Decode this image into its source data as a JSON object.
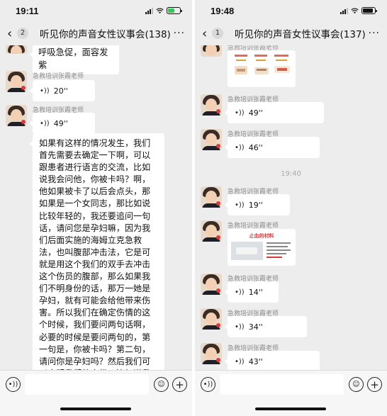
{
  "left": {
    "status": {
      "time": "19:11"
    },
    "nav": {
      "back_count": "2",
      "title": "听见你的声音女性议事会(138)",
      "more": "···"
    },
    "messages": {
      "top_text": "呼吸急促，面容发紫",
      "m1_sender": "急救培训张霞老师",
      "m1_duration": "20''",
      "m2_sender": "急救培训张霞老师",
      "m2_duration": "49''",
      "long_text": "如果有这样的情况发生，我们首先需要去确定一下啊，可以跟患者进行语言的交流，比如说我会问他，你被卡吗？啊，他如果被卡了以后会点头，那如果是一个女同志，那比如说比较年轻的，我还要追问一句话，请问您是孕妇嘛，因为我们后面实施的海姆立克急救法，也叫腹部冲击法，它是可就是用这个我们的双手去冲击这个伤员的腹部，那么如果我们不明身份的话，那万一她是孕妇，就有可能会给他带来伤害。所以我们在确定伤情的这个时候，我们要问两句话啊，必要的时候是要问两句的，第一句是，你被卡吗？第二句，请问你是孕妇吗？然后我们可以亮明我们的身份，比如说我学过急救，我可以帮助你。"
    }
  },
  "right": {
    "status": {
      "time": "19:48"
    },
    "nav": {
      "back_count": "1",
      "title": "听见你的声音女性议事会(137)",
      "more": "···"
    },
    "messages": {
      "top_sender": "急救培训张霞老师",
      "m1_sender": "急救培训张霞老师",
      "m1_duration": "49''",
      "m2_sender": "急救培训张霞老师",
      "m2_duration": "46''",
      "time_sep": "19:40",
      "m3_sender": "急救培训张霞老师",
      "m3_duration": "19''",
      "m4_sender": "急救培训张霞老师",
      "m4_image_title": "止血的材料",
      "m5_sender": "急救培训张霞老师",
      "m5_duration": "14''",
      "m6_sender": "急救培训张霞老师",
      "m6_duration": "34''",
      "m7_sender": "急救培训张霞老师",
      "m7_duration": "43''"
    }
  },
  "icons": {
    "voice_wave": "voice-wave-icon",
    "voice_toggle": "voice-toggle-icon",
    "emoji": "emoji-icon",
    "plus": "plus-icon"
  },
  "colors": {
    "chat_bg": "#ededed",
    "bubble": "#ffffff",
    "accent_red": "#d93a3a"
  }
}
